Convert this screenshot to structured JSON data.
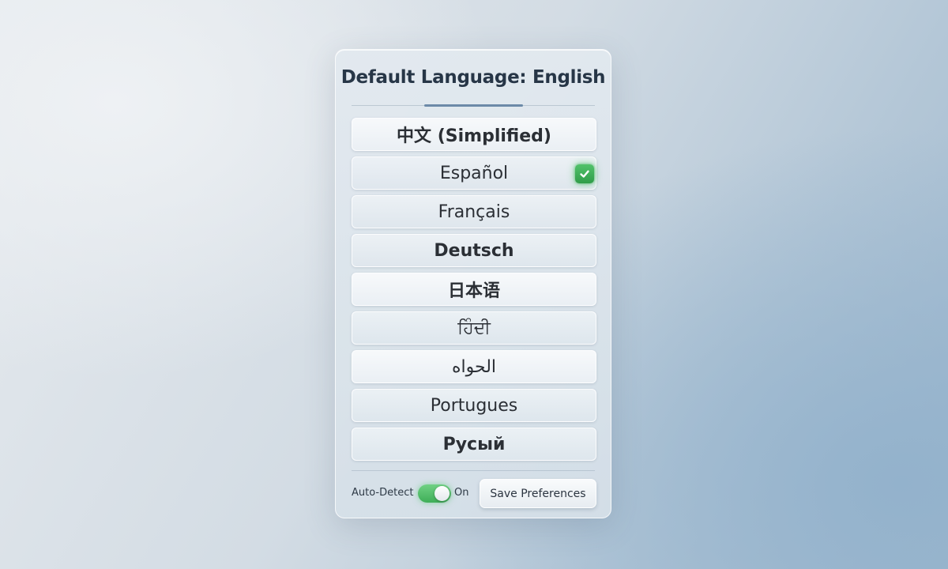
{
  "panel": {
    "title": "Default Language: English"
  },
  "languages": [
    {
      "label": "中文 (Simplified)",
      "selected": false
    },
    {
      "label": "Español",
      "selected": true,
      "check_icon": "checkmark-icon",
      "check_color": "#3fae58"
    },
    {
      "label": "Français",
      "selected": false
    },
    {
      "label": "Deutsch",
      "selected": false
    },
    {
      "label": "日本语",
      "selected": false
    },
    {
      "label": "ਹਿੰਦੀ",
      "selected": false
    },
    {
      "label": "الحواه",
      "selected": false
    },
    {
      "label": "Portugues",
      "selected": false
    },
    {
      "label": "Русый",
      "selected": false
    }
  ],
  "footer": {
    "auto_detect_label": "Auto-Detect",
    "auto_detect_enabled": true,
    "auto_detect_state": "On",
    "toggle_color": "#3fae58",
    "save_label": "Save Preferences"
  }
}
